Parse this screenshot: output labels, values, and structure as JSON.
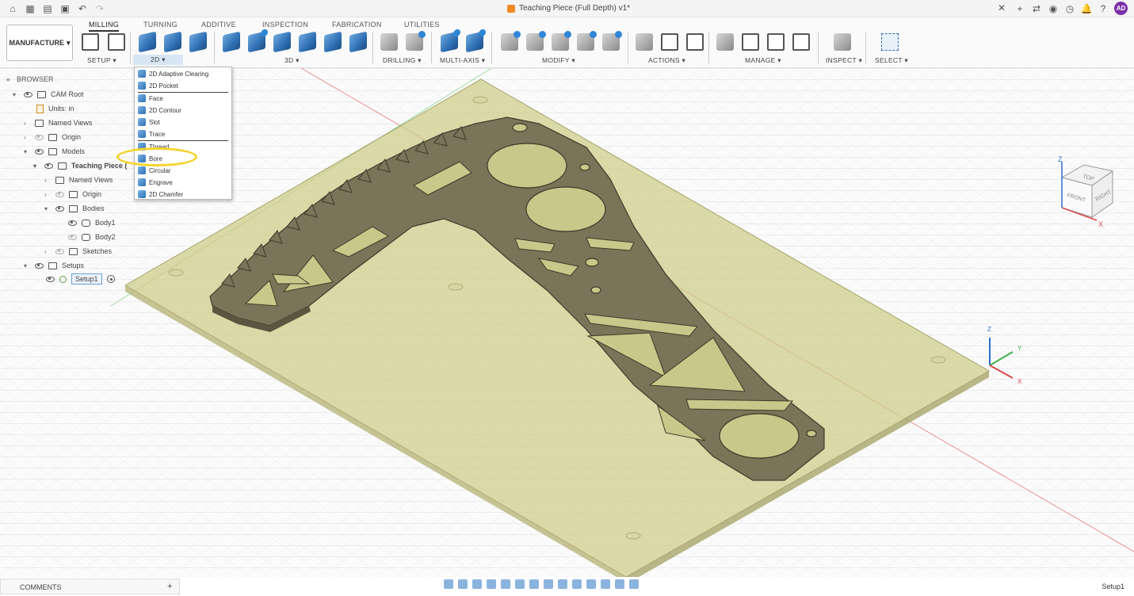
{
  "title": {
    "document": "Teaching Piece (Full Depth) v1*"
  },
  "window": {
    "close_glyph": "✕"
  },
  "user": {
    "initials": "AD"
  },
  "ribbon": {
    "workspace": "MANUFACTURE",
    "tabs": [
      "MILLING",
      "TURNING",
      "ADDITIVE",
      "INSPECTION",
      "FABRICATION",
      "UTILITIES"
    ],
    "groups": [
      "SETUP ▾",
      "2D ▾",
      "3D ▾",
      "DRILLING ▾",
      "MULTI-AXIS ▾",
      "MODIFY ▾",
      "ACTIONS ▾",
      "MANAGE ▾",
      "INSPECT ▾",
      "SELECT ▾"
    ]
  },
  "browser": {
    "title": "BROWSER",
    "items": [
      "CAM Root",
      "Units: in",
      "Named Views",
      "Origin",
      "Models",
      "Teaching Piece (",
      "Named Views",
      "Origin",
      "Bodies",
      "Body1",
      "Body2",
      "Sketches",
      "Setups",
      "Setup1"
    ]
  },
  "dropdown": {
    "items": [
      "2D Adaptive Clearing",
      "2D Pocket",
      "Face",
      "2D Contour",
      "Slot",
      "Trace",
      "Thread",
      "Bore",
      "Circular",
      "Engrave",
      "2D Chamfer"
    ]
  },
  "viewcube": {
    "faces": [
      "TOP",
      "FRONT",
      "RIGHT"
    ],
    "axes": [
      "Z",
      "X"
    ]
  },
  "triad": {
    "axes": [
      "Z",
      "Y",
      "X"
    ]
  },
  "footer": {
    "comments": "COMMENTS",
    "comments_add": "+",
    "status": "Setup1"
  },
  "colors": {
    "stock": "#c9c78a",
    "part": "#7a7458",
    "accent": "#2f6fb3",
    "highlight": "#f5d32a"
  }
}
